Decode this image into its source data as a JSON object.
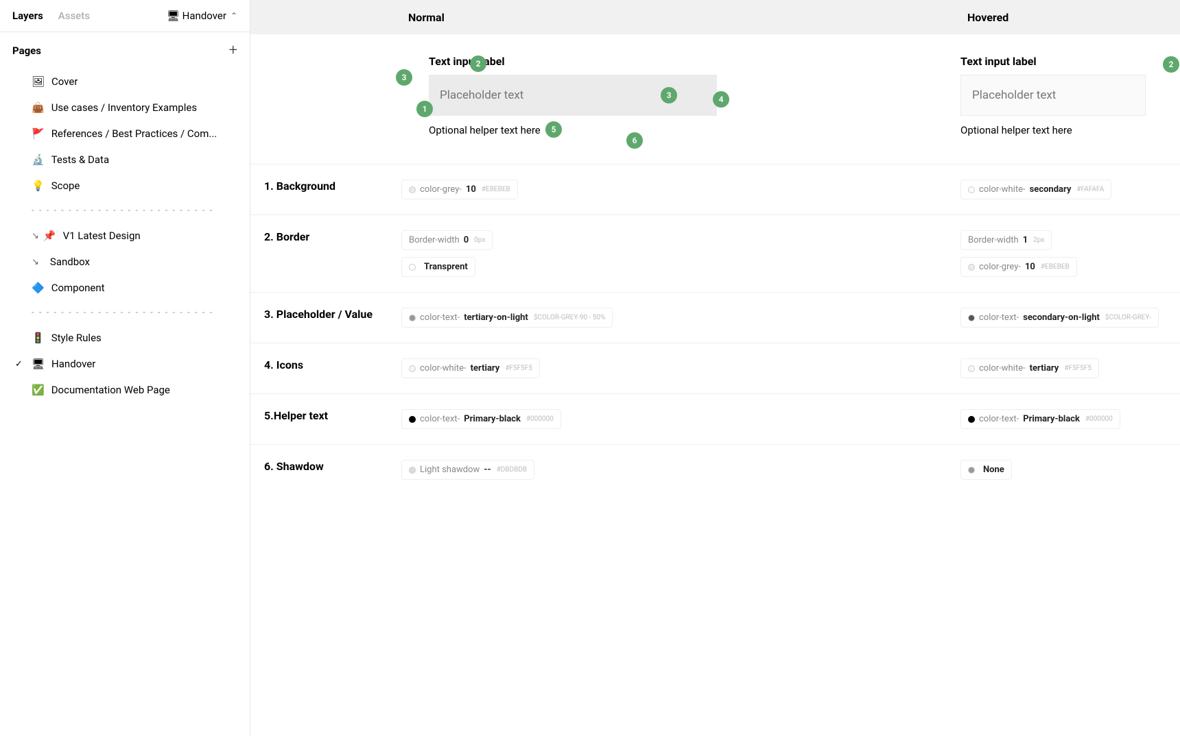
{
  "sidebar": {
    "tabs": {
      "layers": "Layers",
      "assets": "Assets"
    },
    "current_page": "🖥 Handover",
    "pages_heading": "Pages",
    "items": [
      {
        "emoji": "🖼",
        "label": "Cover"
      },
      {
        "emoji": "👜",
        "label": "Use cases / Inventory Examples"
      },
      {
        "emoji": "🚩",
        "label": "References  / Best Practices / Com..."
      },
      {
        "emoji": "🔬",
        "label": "Tests & Data"
      },
      {
        "emoji": "💡",
        "label": "Scope"
      }
    ],
    "divider": "- - - - - - - - - - - - - - - - - - - - - - - - -",
    "items2": [
      {
        "prefix": "↘",
        "emoji": "📌",
        "label": "V1  Latest Design"
      },
      {
        "prefix": "↘",
        "emoji": "",
        "label": "Sandbox"
      },
      {
        "prefix": "",
        "emoji": "🔷",
        "label": "Component"
      }
    ],
    "items3": [
      {
        "emoji": "🚦",
        "label": "Style Rules"
      },
      {
        "emoji": "🖥",
        "label": "Handover",
        "active": true
      },
      {
        "emoji": "✅",
        "label": "Documentation Web Page"
      }
    ]
  },
  "header": {
    "normal": "Normal",
    "hovered": "Hovered"
  },
  "preview": {
    "label": "Text input label",
    "placeholder": "Placeholder text",
    "helper": "Optional helper text here"
  },
  "specs": [
    {
      "label": "1. Background",
      "normal": [
        {
          "prefix": "color-grey-",
          "bold": "10",
          "hex": "#EBEBEB",
          "swatch": "#ebebeb"
        }
      ],
      "hovered": [
        {
          "prefix": "color-white-",
          "bold": "secondary",
          "hex": "#FAFAFA",
          "swatch": "#fafafa"
        }
      ]
    },
    {
      "label": "2. Border",
      "normal": [
        {
          "prefix": "Border-width ",
          "bold": "0",
          "hex": "0px",
          "swatch": ""
        },
        {
          "prefix": "",
          "bold": "Transprent",
          "hex": "",
          "swatch": "transparent"
        }
      ],
      "hovered": [
        {
          "prefix": "Border-width ",
          "bold": "1",
          "hex": "2px",
          "swatch": ""
        },
        {
          "prefix": "color-grey-",
          "bold": "10",
          "hex": "#EBEBEB",
          "swatch": "#ebebeb"
        }
      ]
    },
    {
      "label": "3. Placeholder / Value",
      "normal": [
        {
          "prefix": "color-text-",
          "bold": "tertiary-on-light",
          "hex": "$COLOR-GREY-90 - 50%",
          "swatch": "#999"
        }
      ],
      "hovered": [
        {
          "prefix": "color-text-",
          "bold": "secondary-on-light",
          "hex": "$COLOR-GREY-",
          "swatch": "#555"
        }
      ]
    },
    {
      "label": "4. Icons",
      "normal": [
        {
          "prefix": "color-white-",
          "bold": "tertiary",
          "hex": "#F5F5F5",
          "swatch": "#f5f5f5"
        }
      ],
      "hovered": [
        {
          "prefix": "color-white-",
          "bold": "tertiary",
          "hex": "#F5F5F5",
          "swatch": "#f5f5f5"
        }
      ]
    },
    {
      "label": "5.Helper text",
      "normal": [
        {
          "prefix": "color-text-",
          "bold": "Primary-black",
          "hex": "#000000",
          "swatch": "#000"
        }
      ],
      "hovered": [
        {
          "prefix": "color-text-",
          "bold": "Primary-black",
          "hex": "#000000",
          "swatch": "#000"
        }
      ]
    },
    {
      "label": "6. Shawdow",
      "normal": [
        {
          "prefix": "Light shawdow ",
          "bold": "--",
          "hex": "#DBDBDB",
          "swatch": "#dbdbdb"
        }
      ],
      "hovered": [
        {
          "prefix": "",
          "bold": "None",
          "hex": "",
          "swatch": "#999"
        }
      ]
    }
  ]
}
